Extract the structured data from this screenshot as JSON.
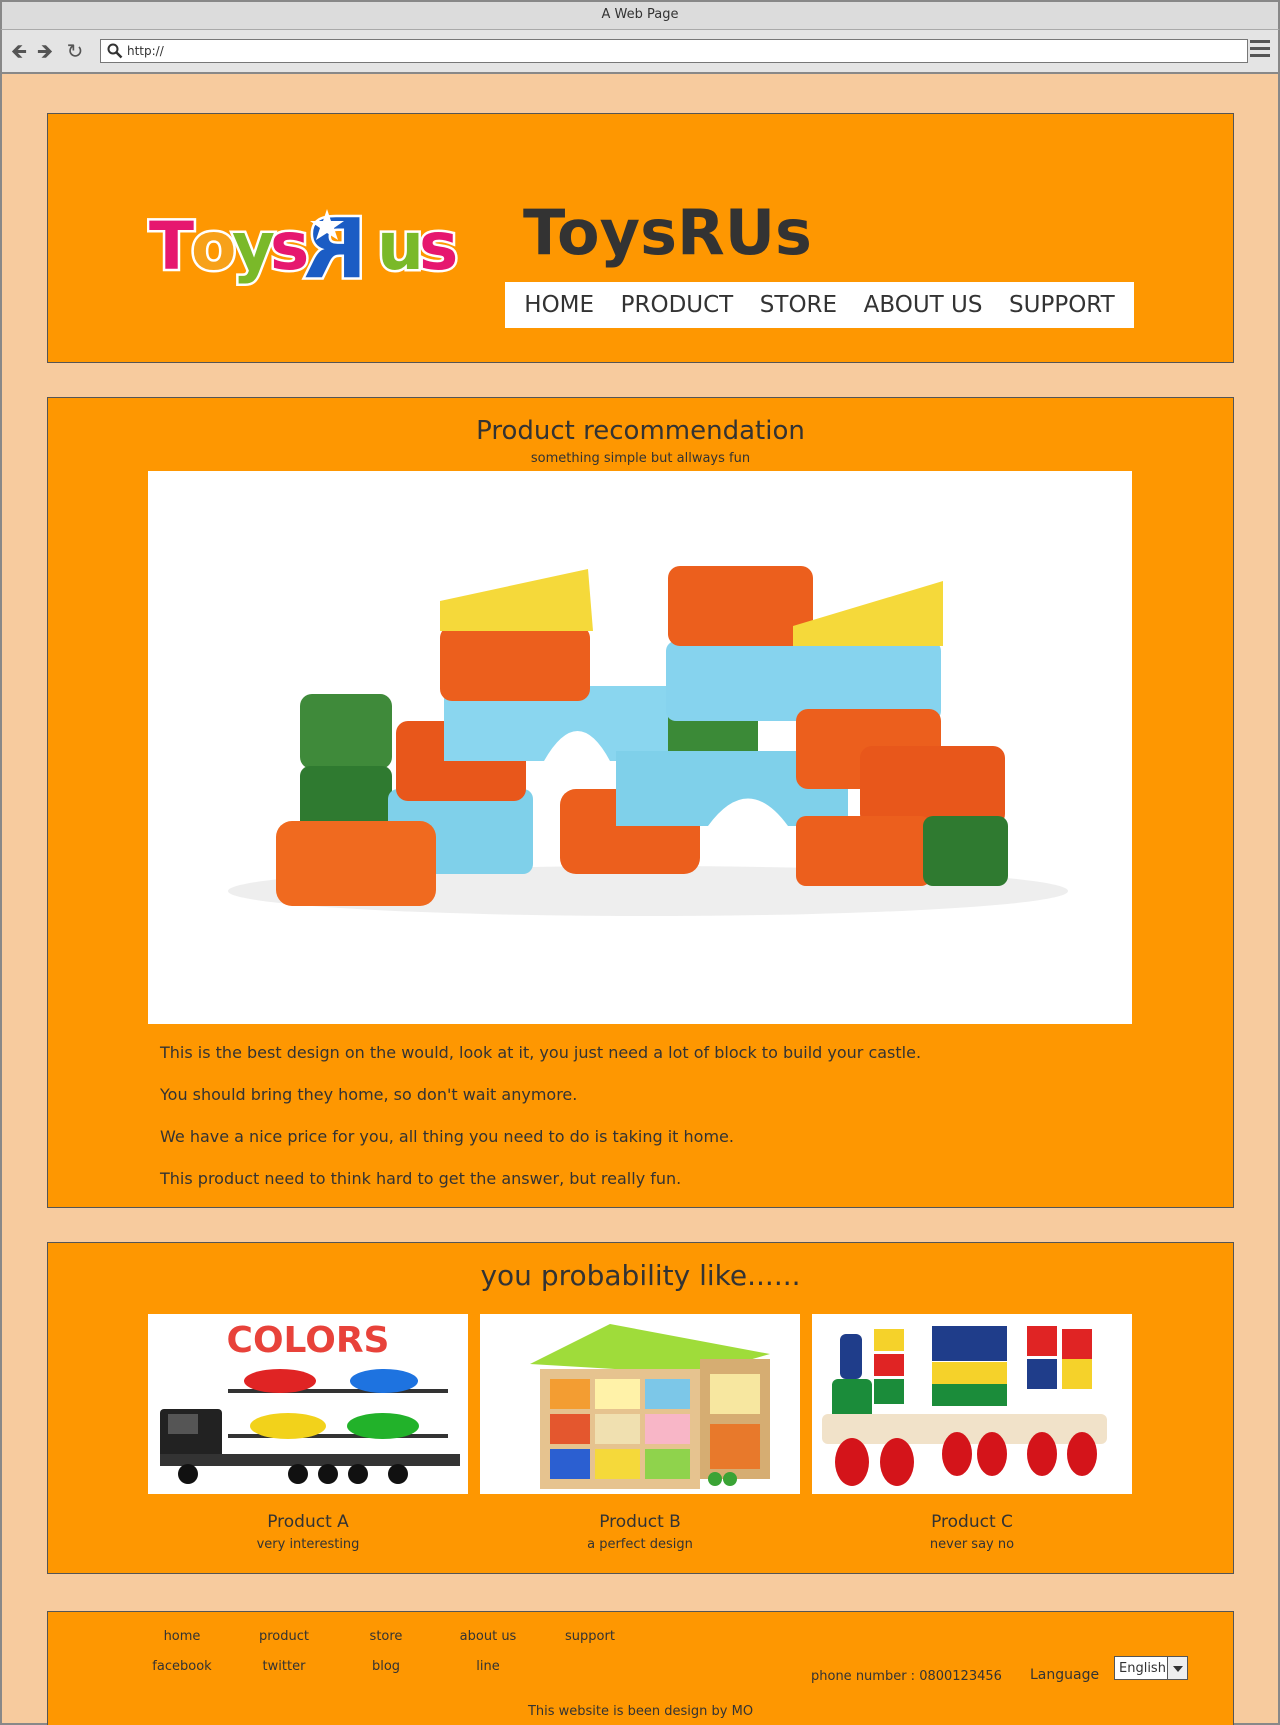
{
  "browser": {
    "window_title": "A Web Page",
    "url": "http://"
  },
  "header": {
    "logo_text": "ToysRUs",
    "site_title": "ToysRUs",
    "nav": [
      "HOME",
      "PRODUCT",
      "STORE",
      "ABOUT US",
      "SUPPORT"
    ]
  },
  "recommendation": {
    "title": "Product recommendation",
    "subtitle": "something simple but allways fun",
    "paragraphs": [
      "This is the best design on the would, look at it, you just need a lot of block to build your castle.",
      "You should bring they home, so don't wait anymore.",
      "We have a nice price for you, all thing you need to do is taking it home.",
      "This product need to think hard to get the answer, but really fun."
    ]
  },
  "likes": {
    "title": "you probability like......",
    "products": [
      {
        "name": "Product A",
        "desc": "very interesting",
        "banner": "COLORS"
      },
      {
        "name": "Product B",
        "desc": "a perfect design"
      },
      {
        "name": "Product C",
        "desc": "never say no"
      }
    ]
  },
  "footer": {
    "links_row1": [
      "home",
      "product",
      "store",
      "about us",
      "support"
    ],
    "links_row2": [
      "facebook",
      "twitter",
      "blog",
      "line"
    ],
    "phone": "phone number : 0800123456",
    "language_label": "Language",
    "language_value": "English",
    "credit": "This website is been design by MO"
  },
  "colors": {
    "page_bg": "#f7cb9e",
    "panel_bg": "#fe9701",
    "text": "#333333"
  }
}
